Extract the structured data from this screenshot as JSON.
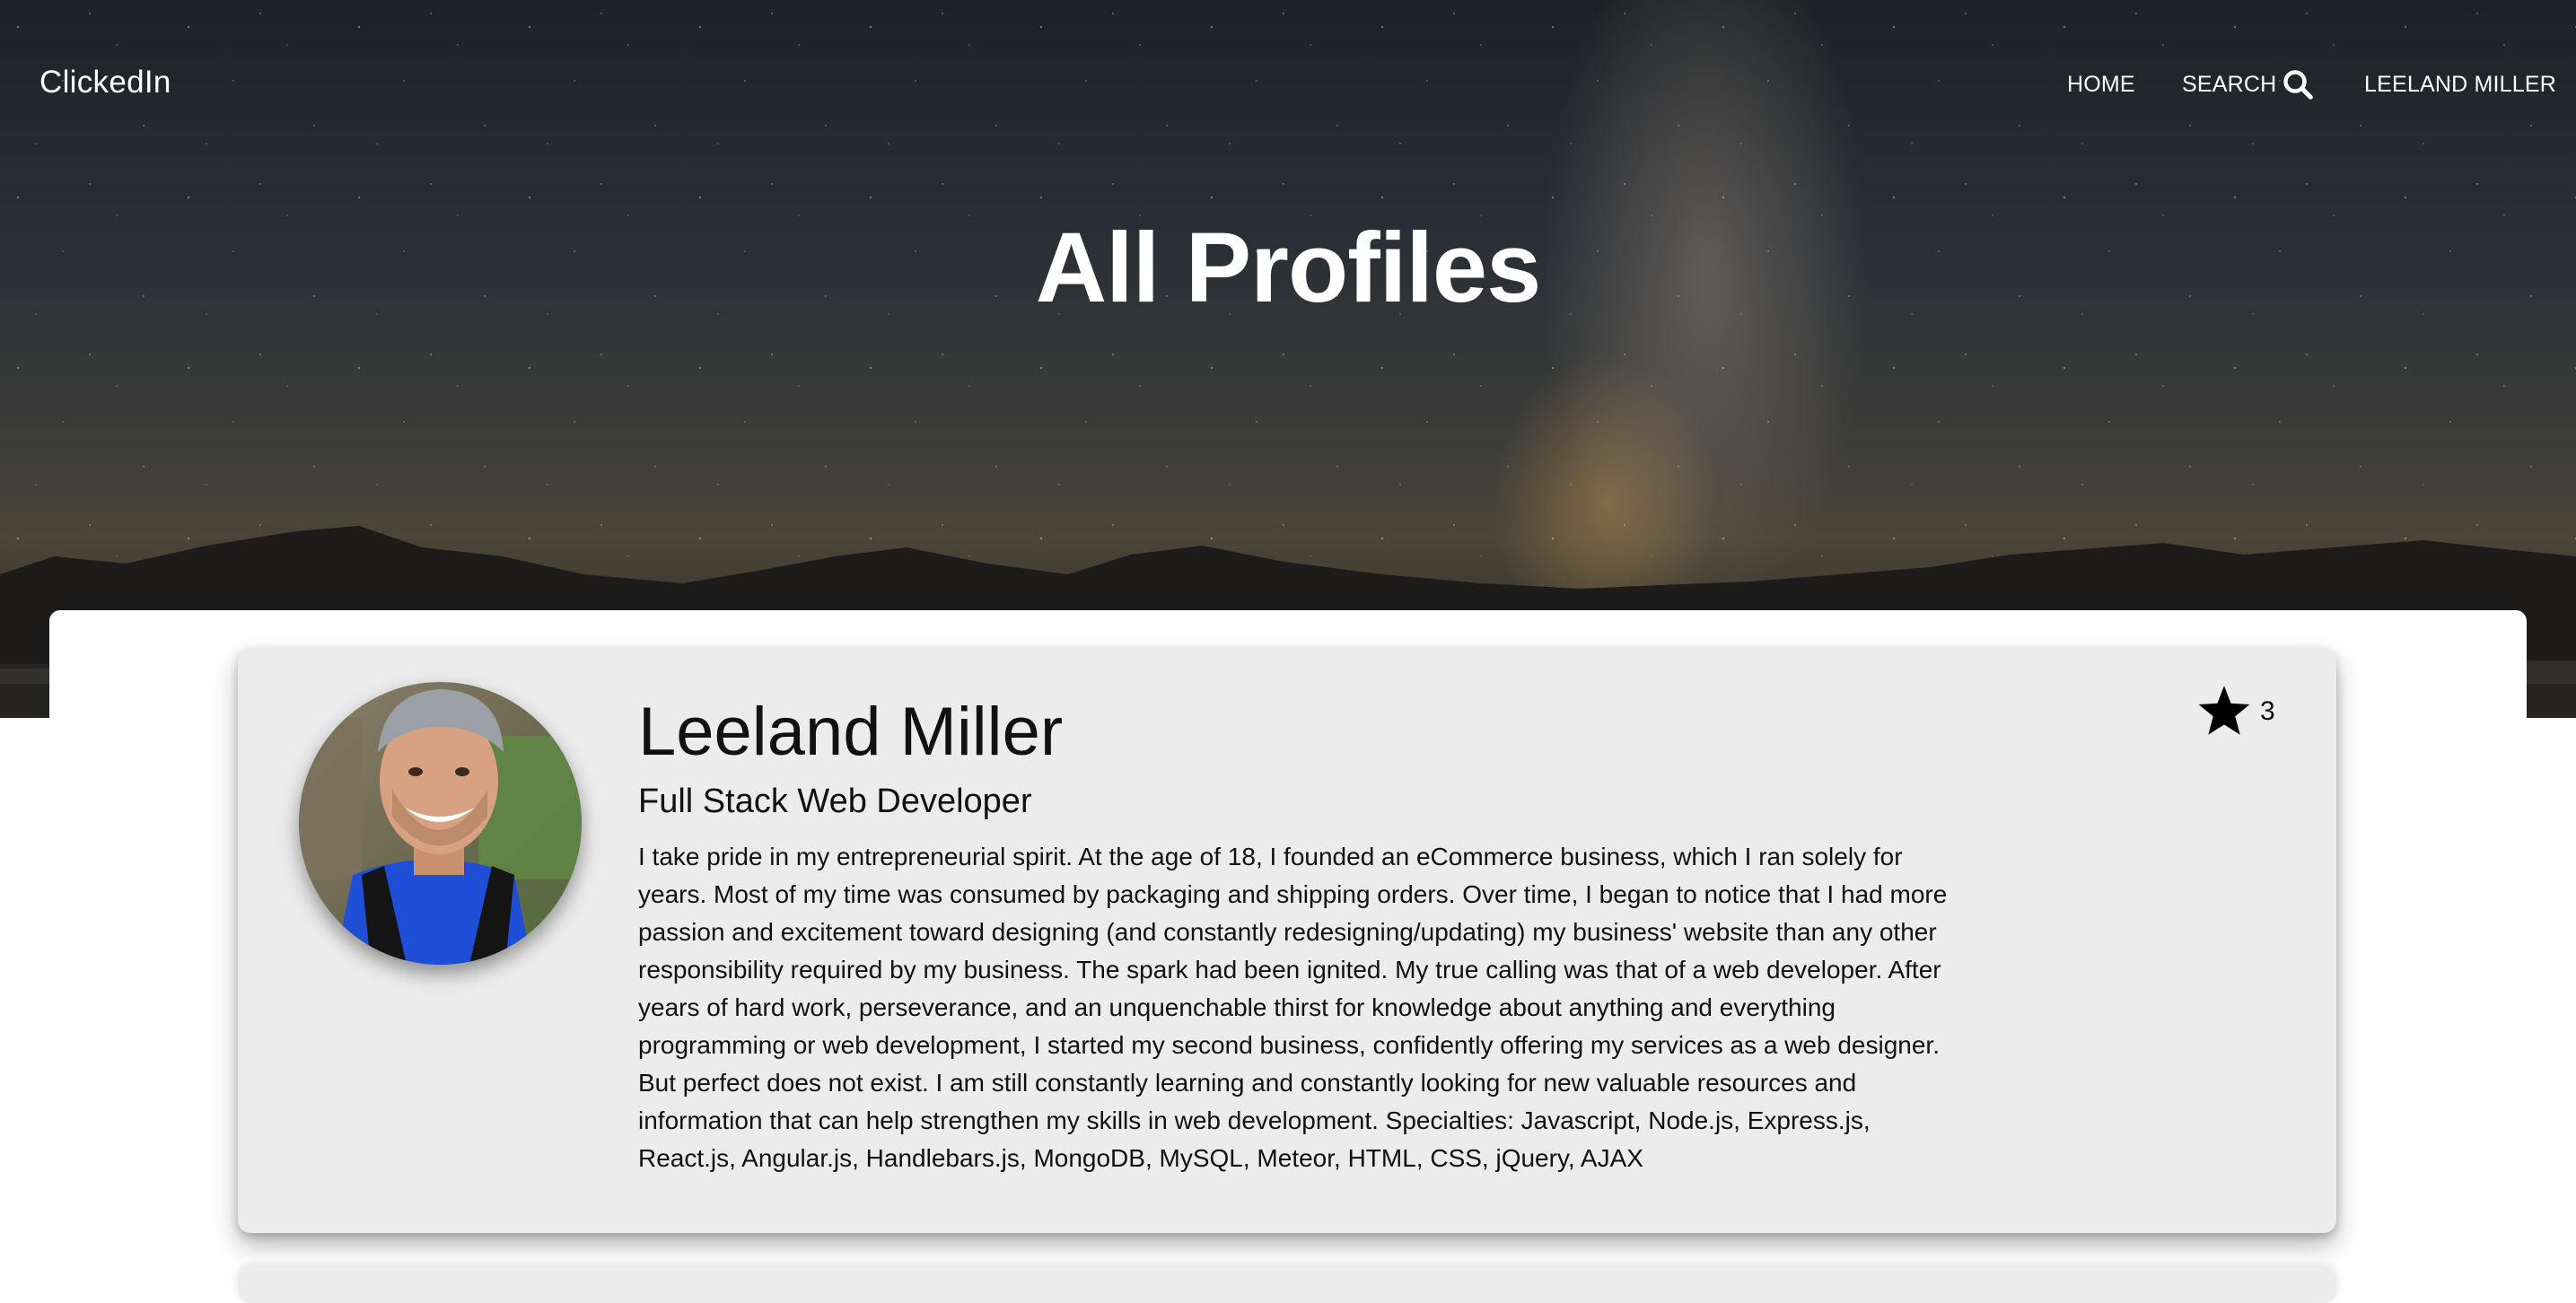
{
  "navbar": {
    "brand": "ClickedIn",
    "home": "HOME",
    "search": "SEARCH",
    "search_icon": "search-icon",
    "user": "LEELAND MILLER"
  },
  "hero": {
    "title": "All Profiles"
  },
  "profiles": [
    {
      "name": "Leeland Miller",
      "title": "Full Stack Web Developer",
      "bio": "I take pride in my entrepreneurial spirit. At the age of 18, I founded an eCommerce business, which I ran solely for years. Most of my time was consumed by packaging and shipping orders. Over time, I began to notice that I had more passion and excitement toward designing (and constantly redesigning/updating) my business' website than any other responsibility required by my business. The spark had been ignited. My true calling was that of a web developer. After years of hard work, perseverance, and an unquenchable thirst for knowledge about anything and everything programming or web development, I started my second business, confidently offering my services as a web designer. But perfect does not exist. I am still constantly learning and constantly looking for new valuable resources and information that can help strengthen my skills in web development. Specialties: Javascript, Node.js, Express.js, React.js, Angular.js, Handlebars.js, MongoDB, MySQL, Meteor, HTML, CSS, jQuery, AJAX",
      "stars": "3",
      "star_icon": "star-icon"
    }
  ],
  "colors": {
    "card_background": "#ececec",
    "nav_text": "#ffffff",
    "body_text": "#111111"
  }
}
